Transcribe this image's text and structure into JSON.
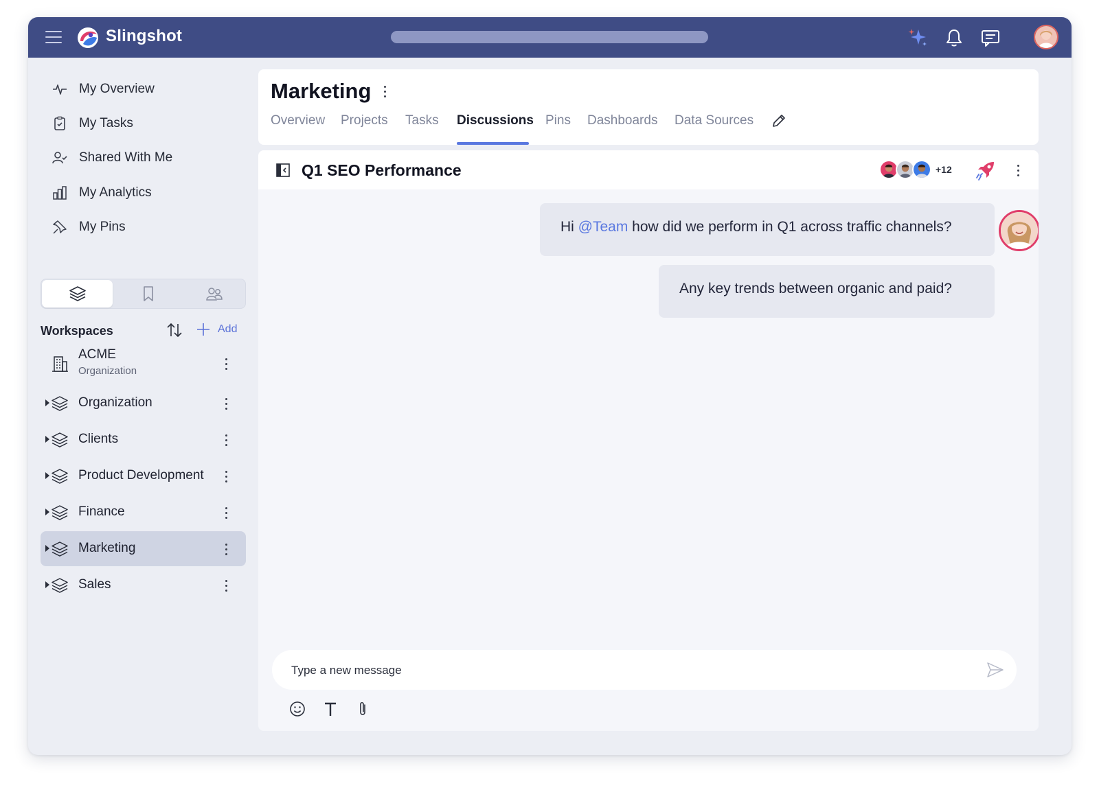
{
  "app": {
    "name": "Slingshot"
  },
  "topbar": {
    "icons": [
      "menu-icon",
      "sparkles-icon",
      "bell-icon",
      "chat-icon",
      "user-avatar"
    ]
  },
  "sidebar": {
    "nav": [
      {
        "label": "My Overview",
        "icon": "pulse-icon"
      },
      {
        "label": "My Tasks",
        "icon": "clipboard-icon"
      },
      {
        "label": "Shared With Me",
        "icon": "user-check-icon"
      },
      {
        "label": "My Analytics",
        "icon": "bar-chart-icon"
      },
      {
        "label": "My Pins",
        "icon": "pin-icon"
      }
    ],
    "segments": [
      "layers-icon",
      "bookmark-icon",
      "people-icon"
    ],
    "workspaces_title": "Workspaces",
    "add_label": "Add",
    "org": {
      "name": "ACME",
      "subtitle": "Organization"
    },
    "workspaces": [
      {
        "label": "Organization",
        "active": false
      },
      {
        "label": "Clients",
        "active": false
      },
      {
        "label": "Product Development",
        "active": false
      },
      {
        "label": "Finance",
        "active": false
      },
      {
        "label": "Marketing",
        "active": true
      },
      {
        "label": "Sales",
        "active": false
      }
    ]
  },
  "main": {
    "title": "Marketing",
    "tabs": [
      {
        "label": "Overview",
        "active": false
      },
      {
        "label": "Projects",
        "active": false
      },
      {
        "label": "Tasks",
        "active": false
      },
      {
        "label": "Discussions",
        "active": true
      },
      {
        "label": "Pins",
        "active": false
      },
      {
        "label": "Dashboards",
        "active": false
      },
      {
        "label": "Data Sources",
        "active": false
      }
    ]
  },
  "discussion": {
    "title": "Q1 SEO Performance",
    "participants_extra": "+12",
    "messages": [
      {
        "prefix": "Hi ",
        "mention": "@Team",
        "text": " how did we perform in Q1 across traffic channels?"
      },
      {
        "text": "Any key trends between organic and paid?"
      }
    ],
    "composer_placeholder": "Type a new message"
  },
  "colors": {
    "topbar": "#3f4c85",
    "accent": "#5a78e0",
    "brand_red": "#e03e6a",
    "active_row": "#cfd4e3"
  }
}
